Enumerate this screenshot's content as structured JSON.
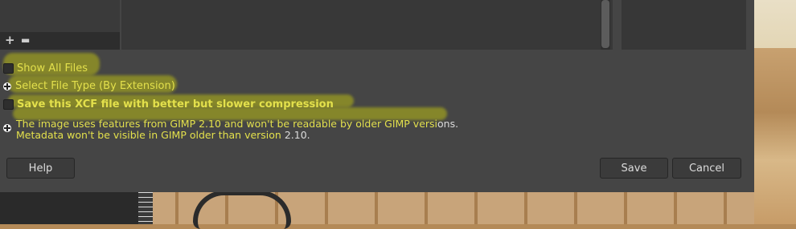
{
  "dialog": {
    "places": {
      "add_icon": "plus-icon",
      "remove_icon": "minus-icon"
    },
    "options": {
      "show_all_files": "Show All Files",
      "select_file_type": "Select File Type (By Extension)",
      "compression": "Save this XCF file with better but slower compression"
    },
    "notice": {
      "line1_a": "The image uses features from GIMP 2.10 and won't be readable by older GIMP versi",
      "line1_b": "ons.",
      "line2_a": "Metadata won't be visible in GIMP older than version ",
      "line2_b": "2.10."
    },
    "buttons": {
      "help": "Help",
      "save": "Save",
      "cancel": "Cancel"
    }
  },
  "colors": {
    "highlight": "#b9bc14",
    "dialog_bg": "#454545"
  }
}
